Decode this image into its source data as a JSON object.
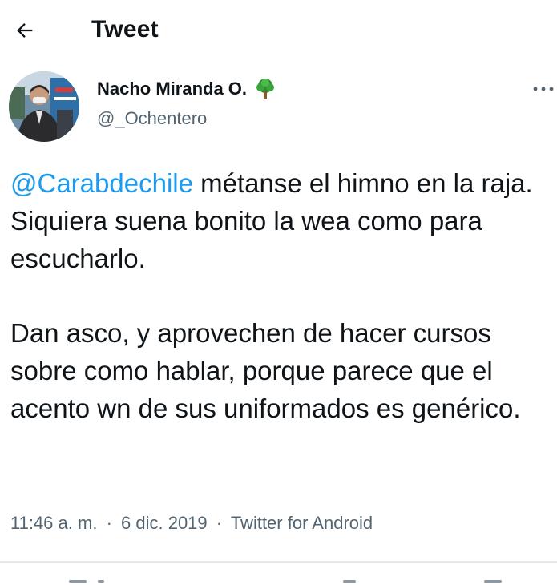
{
  "header": {
    "title": "Tweet",
    "back_icon": "arrow-left-icon"
  },
  "author": {
    "name": "Nacho Miranda O.",
    "handle": "@_Ochentero",
    "emoji_icon": "tree-icon",
    "avatar": "avatar-photo"
  },
  "tweet": {
    "mention": "@Carabdechile",
    "paragraph1_rest": " métanse el himno en la raja. Siquiera suena bonito la wea como para escucharlo.",
    "paragraph2": "Dan asco, y aprovechen de hacer cursos sobre como hablar, porque parece que el acento wn de sus uniformados es genérico."
  },
  "meta": {
    "time": "11:46 a. m.",
    "separator": "·",
    "date": "6 dic. 2019",
    "source": "Twitter for Android"
  },
  "more_icon": "more-horizontal-icon",
  "colors": {
    "mention": "#1d9bf0",
    "secondary_text": "#536471",
    "primary_text": "#0f1419"
  }
}
